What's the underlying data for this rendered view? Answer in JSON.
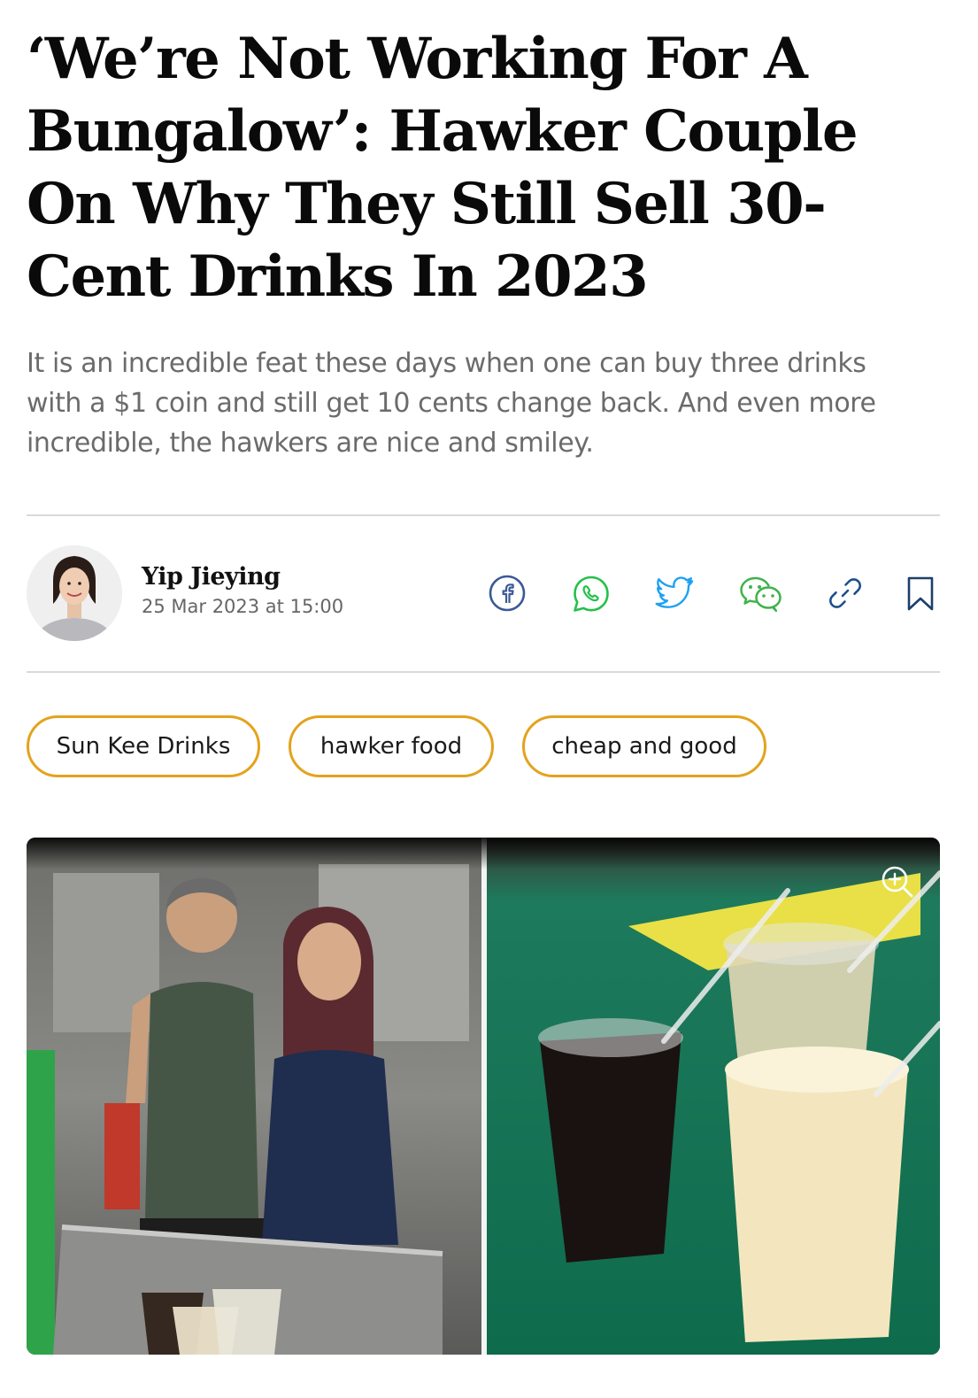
{
  "article": {
    "headline": "‘We’re Not Working For A Bungalow’: Hawker Couple On Why They Still Sell 30-Cent Drinks In 2023",
    "standfirst": "It is an incredible feat these days when one can buy three drinks with a $1 coin and still get 10 cents change back. And even more incredible, the hawkers are nice and smiley."
  },
  "byline": {
    "author_name": "Yip Jieying",
    "date": "25 Mar 2023 at 15:00",
    "share_icons": [
      "facebook-icon",
      "whatsapp-icon",
      "twitter-icon",
      "wechat-icon",
      "copy-link-icon",
      "bookmark-icon"
    ]
  },
  "tags": [
    "Sun Kee Drinks",
    "hawker food",
    "cheap and good"
  ],
  "colors": {
    "tag_border": "#e3a31d",
    "facebook": "#3b5998",
    "whatsapp": "#25c04a",
    "twitter": "#1da1f2",
    "wechat": "#3fb34a",
    "link": "#1d4f8c",
    "bookmark": "#1d3f6b"
  },
  "hero": {
    "zoom_icon": "zoom-in-icon"
  }
}
